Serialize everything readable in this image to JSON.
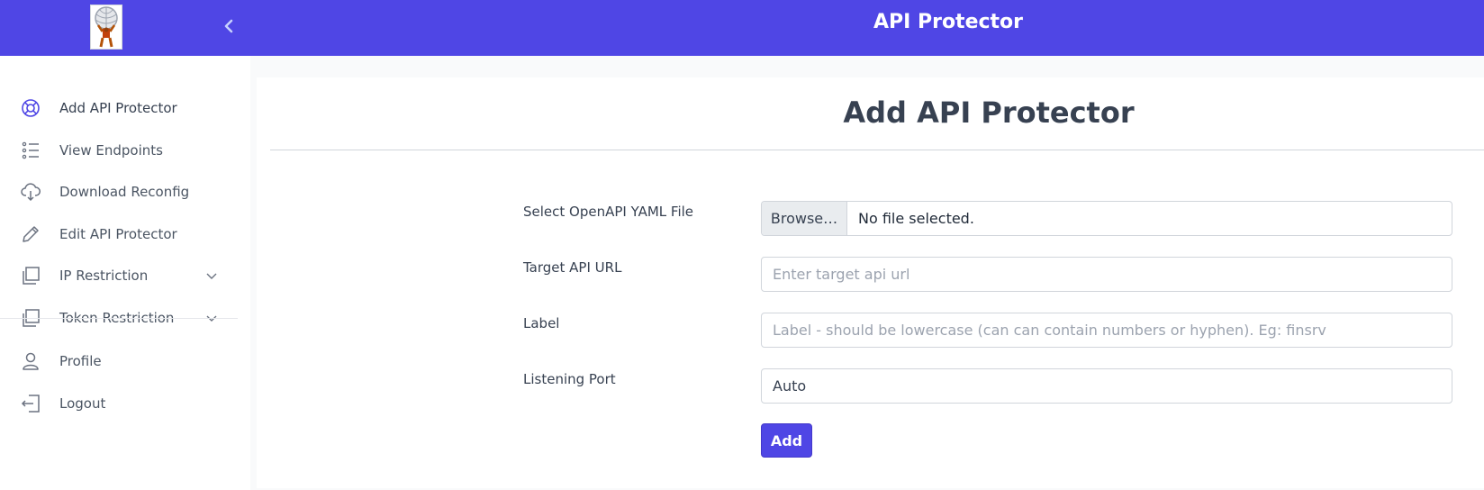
{
  "header": {
    "title": "API Protector"
  },
  "sidebar": {
    "items": [
      {
        "label": "Add API Protector",
        "icon": "lifebuoy-icon"
      },
      {
        "label": "View Endpoints",
        "icon": "list-icon"
      },
      {
        "label": "Download Reconfig",
        "icon": "cloud-download-icon"
      },
      {
        "label": "Edit API Protector",
        "icon": "pencil-icon"
      },
      {
        "label": "IP Restriction",
        "icon": "copy-icon"
      },
      {
        "label": "Token Restriction",
        "icon": "copy-icon"
      },
      {
        "label": "Profile",
        "icon": "user-icon"
      },
      {
        "label": "Logout",
        "icon": "logout-icon"
      }
    ]
  },
  "form": {
    "title": "Add API Protector",
    "file_label": "Select OpenAPI YAML File",
    "browse_label": "Browse…",
    "file_status": "No file selected.",
    "url_label": "Target API URL",
    "url_placeholder": "Enter target api url",
    "label_label": "Label",
    "label_placeholder": "Label - should be lowercase (can can contain numbers or hyphen). Eg: finsrv",
    "port_label": "Listening Port",
    "port_value": "Auto",
    "submit_label": "Add"
  },
  "colors": {
    "accent": "#4f46e5",
    "icon": "#4f46e5",
    "icon_muted": "#6b7280"
  }
}
